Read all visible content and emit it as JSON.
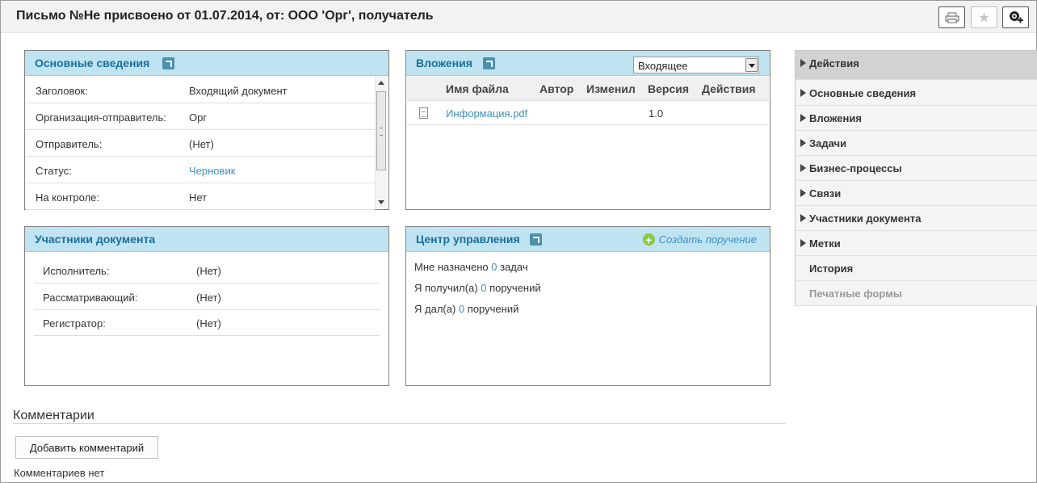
{
  "header": {
    "title": "Письмо №Не присвоено от 01.07.2014, от: ООО 'Орг', получатель"
  },
  "main_info": {
    "title": "Основные сведения",
    "rows": [
      {
        "label": "Заголовок:",
        "value": "Входящий документ"
      },
      {
        "label": "Организация-отправитель:",
        "value": "Орг"
      },
      {
        "label": "Отправитель:",
        "value": "(Нет)"
      },
      {
        "label": "Статус:",
        "value": "Черновик"
      },
      {
        "label": "На контроле:",
        "value": "Нет"
      }
    ]
  },
  "attachments": {
    "title": "Вложения",
    "selected_type": "Входящее",
    "columns": [
      "Имя файла",
      "Автор",
      "Изменил",
      "Версия",
      "Действия"
    ],
    "rows": [
      {
        "file": "Информация.pdf",
        "author": "",
        "modified_by": "",
        "version": "1.0",
        "actions": ""
      }
    ]
  },
  "participants": {
    "title": "Участники документа",
    "rows": [
      {
        "label": "Исполнитель:",
        "value": "(Нет)"
      },
      {
        "label": "Рассматривающий:",
        "value": "(Нет)"
      },
      {
        "label": "Регистратор:",
        "value": "(Нет)"
      }
    ]
  },
  "control_center": {
    "title": "Центр управления",
    "create_label": "Создать поручение",
    "lines": [
      {
        "prefix": "Мне назначено",
        "count": "0",
        "suffix": "задач"
      },
      {
        "prefix": "Я получил(а)",
        "count": "0",
        "suffix": "поручений"
      },
      {
        "prefix": "Я дал(а)",
        "count": "0",
        "suffix": "поручений"
      }
    ]
  },
  "sidebar": {
    "items": [
      {
        "label": "Действия"
      },
      {
        "label": "Основные сведения"
      },
      {
        "label": "Вложения"
      },
      {
        "label": "Задачи"
      },
      {
        "label": "Бизнес-процессы"
      },
      {
        "label": "Связи"
      },
      {
        "label": "Участники документа"
      },
      {
        "label": "Метки"
      },
      {
        "label": "История"
      },
      {
        "label": "Печатные формы"
      }
    ]
  },
  "comments": {
    "title": "Комментарии",
    "add_label": "Добавить комментарий",
    "empty_text": "Комментариев нет"
  },
  "colors": {
    "panel_header": "#bfe3f1",
    "panel_title": "#1a6f99",
    "link": "#3f8fbf",
    "plus_icon": "#8cc63f"
  }
}
